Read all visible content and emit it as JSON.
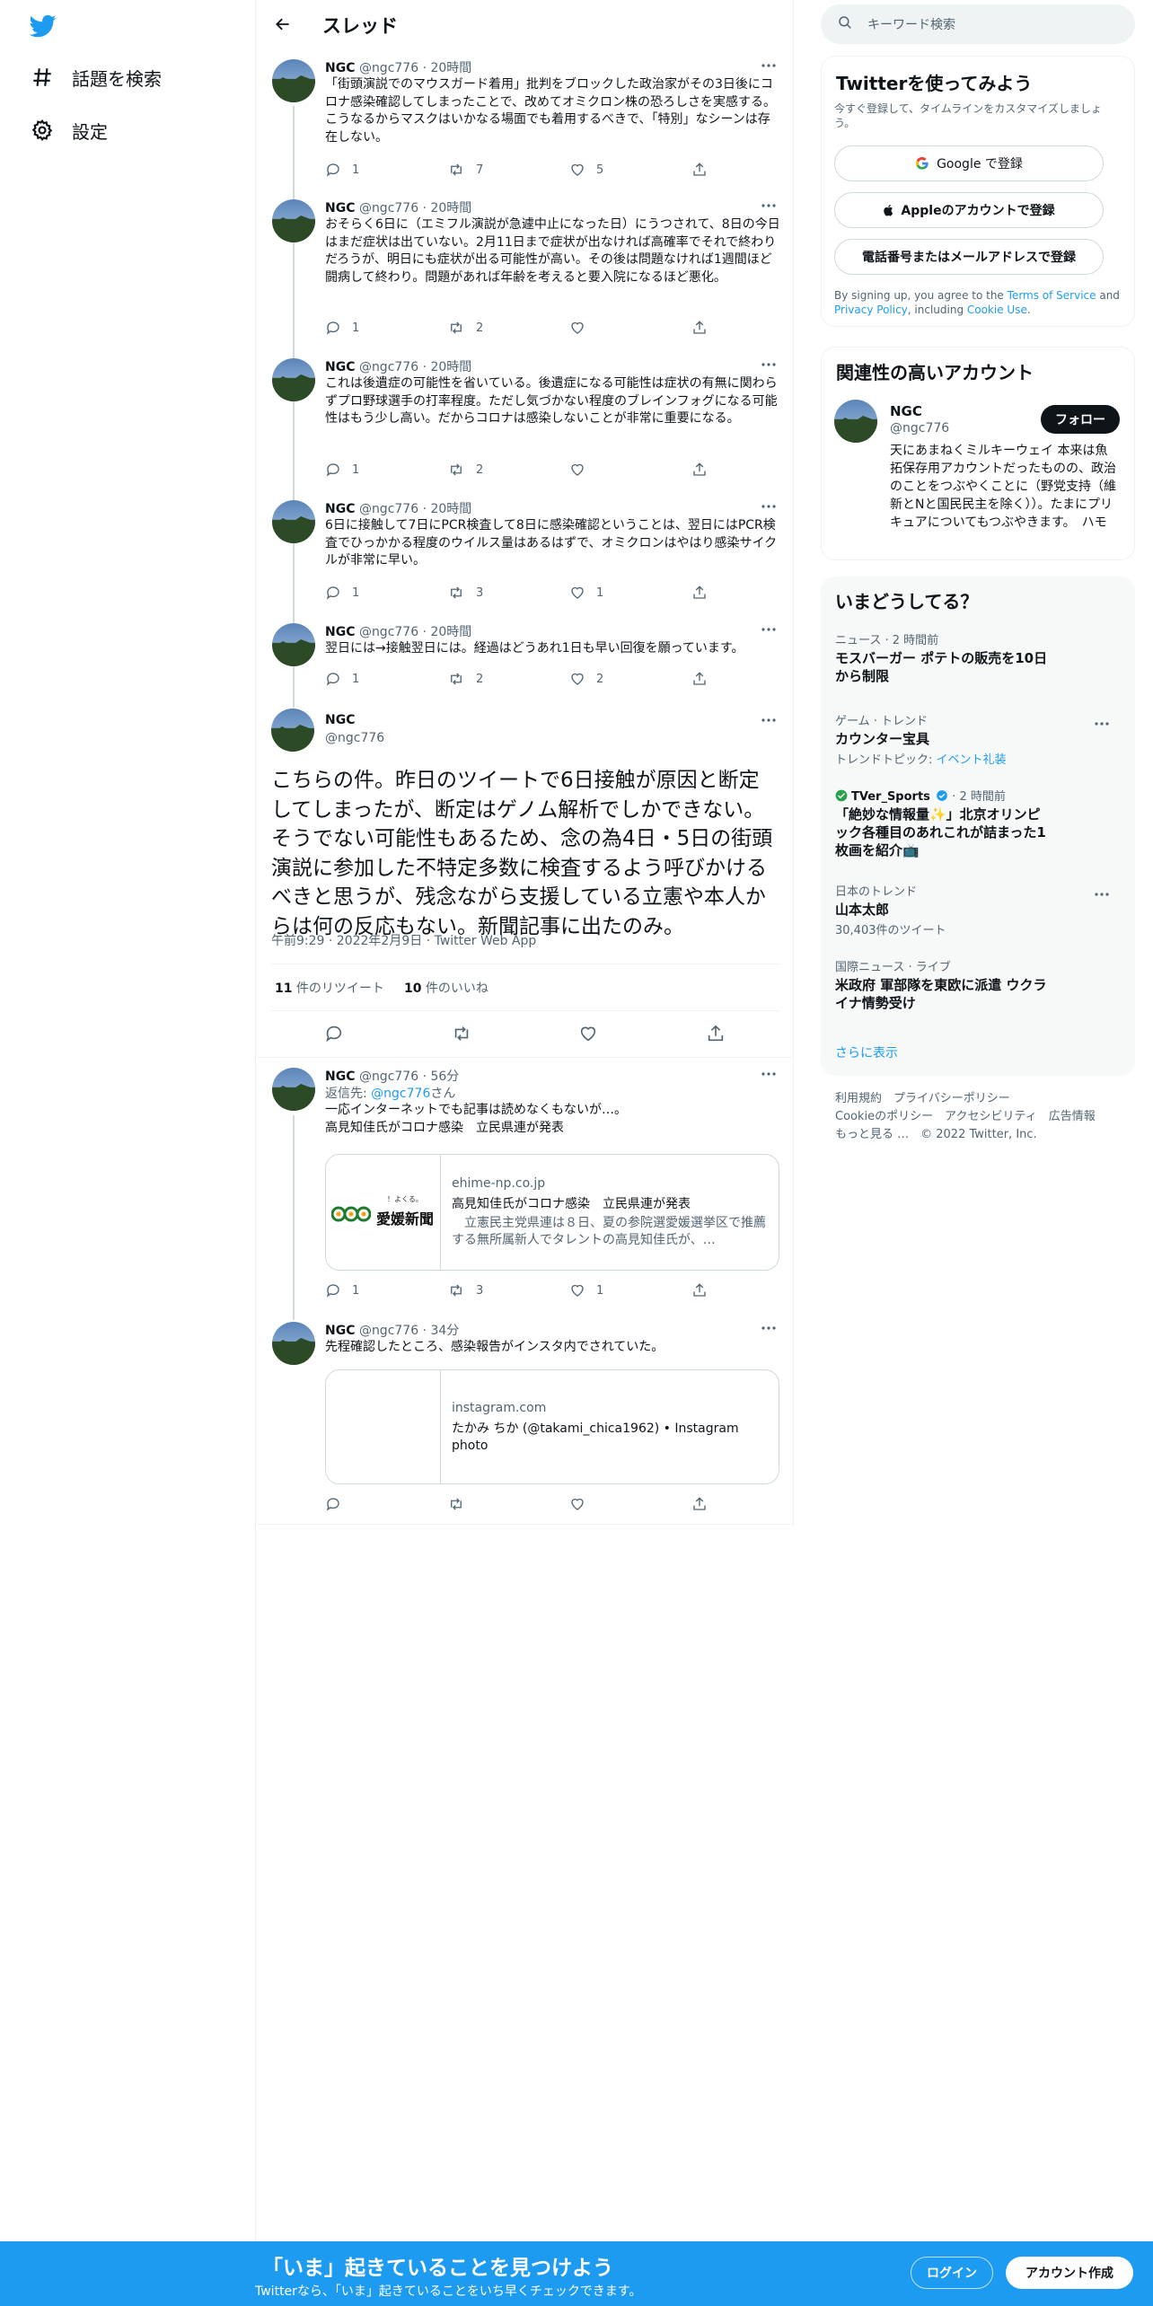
{
  "nav": {
    "explore_label": "話題を検索",
    "settings_label": "設定"
  },
  "header": {
    "title": "スレッド"
  },
  "tweets": [
    {
      "name": "NGC",
      "handle": "@ngc776",
      "time": "20時間",
      "text": "「街頭演説でのマウスガード着用」批判をブロックした政治家がその3日後にコロナ感染確認してしまったことで、改めてオミクロン株の恐ろしさを実感する。こうなるからマスクはいかなる場面でも着用するべきで、「特別」なシーンは存在しない。",
      "replies": "1",
      "retweets": "7",
      "likes": "5"
    },
    {
      "name": "NGC",
      "handle": "@ngc776",
      "time": "20時間",
      "text": "おそらく6日に（エミフル演説が急遽中止になった日）にうつされて、8日の今日はまだ症状は出ていない。2月11日まで症状が出なければ高確率でそれで終わりだろうが、明日にも症状が出る可能性が高い。その後は問題なければ1週間ほど闘病して終わり。問題があれば年齢を考えると要入院になるほど悪化。",
      "replies": "1",
      "retweets": "2",
      "likes": ""
    },
    {
      "name": "NGC",
      "handle": "@ngc776",
      "time": "20時間",
      "text": "これは後遺症の可能性を省いている。後遺症になる可能性は症状の有無に関わらずプロ野球選手の打率程度。ただし気づかない程度のブレインフォグになる可能性はもう少し高い。だからコロナは感染しないことが非常に重要になる。",
      "replies": "1",
      "retweets": "2",
      "likes": ""
    },
    {
      "name": "NGC",
      "handle": "@ngc776",
      "time": "20時間",
      "text": "6日に接触して7日にPCR検査して8日に感染確認ということは、翌日にはPCR検査でひっかかる程度のウイルス量はあるはずで、オミクロンはやはり感染サイクルが非常に早い。",
      "replies": "1",
      "retweets": "3",
      "likes": "1"
    },
    {
      "name": "NGC",
      "handle": "@ngc776",
      "time": "20時間",
      "text": "翌日には→接触翌日には。経過はどうあれ1日も早い回復を願っています。",
      "replies": "1",
      "retweets": "2",
      "likes": "2"
    }
  ],
  "focus": {
    "name": "NGC",
    "handle": "@ngc776",
    "text": "こちらの件。昨日のツイートで6日接触が原因と断定してしまったが、断定はゲノム解析でしかできない。そうでない可能性もあるため、念の為4日・5日の街頭演説に参加した不特定多数に検査するよう呼びかけるべきと思うが、残念ながら支援している立憲や本人からは何の反応もない。新聞記事に出たのみ。",
    "meta": "午前9:29 · 2022年2月9日 · Twitter Web App",
    "retweet_count": "11",
    "retweet_label": " 件のリツイート",
    "like_count": "10",
    "like_label": " 件のいいね"
  },
  "replies": [
    {
      "name": "NGC",
      "handle": "@ngc776",
      "time": "56分",
      "reply_to_label": "返信先: ",
      "reply_to_handle": "@ngc776",
      "reply_to_suffix": "さん",
      "text": "一応インターネットでも記事は読めなくもないが…。\n高見知佳氏がコロナ感染　立民県連が発表",
      "card": {
        "domain": "ehime-np.co.jp",
        "title": "高見知佳氏がコロナ感染　立民県連が発表",
        "desc": "　立憲民主党県連は８日、夏の参院選愛媛選挙区で推薦する無所属新人でタレントの高見知佳氏が、…",
        "logo_text": "愛媛新聞",
        "logo_small": "！よくる。"
      },
      "replies": "1",
      "retweets": "3",
      "likes": "1"
    },
    {
      "name": "NGC",
      "handle": "@ngc776",
      "time": "34分",
      "text": "先程確認したところ、感染報告がインスタ内でされていた。",
      "card": {
        "domain": "instagram.com",
        "title": "たかみ ちか (@takami_chica1962) • Instagram photo"
      },
      "replies": "",
      "retweets": "",
      "likes": ""
    }
  ],
  "search": {
    "placeholder": "キーワード検索"
  },
  "signup": {
    "title": "Twitterを使ってみよう",
    "subtitle": "今すぐ登録して、タイムラインをカスタマイズしましょう。",
    "google": "Google で登録",
    "apple": "Appleのアカウントで登録",
    "phone": "電話番号またはメールアドレスで登録",
    "terms_prefix": "By signing up, you agree to the ",
    "terms_link": "Terms of Service",
    "terms_and": " and ",
    "privacy_link": "Privacy Policy",
    "terms_including": ", including ",
    "cookie_link": "Cookie Use",
    "terms_end": "."
  },
  "related": {
    "title": "関連性の高いアカウント",
    "name": "NGC",
    "handle": "@ngc776",
    "follow": "フォロー",
    "bio": "天にあまねくミルキーウェイ 本来は魚拓保存用アカウントだったものの、政治のことをつぶやくことに（野党支持（維新とNと国民民主を除く））。たまにプリキュアについてもつぶやきます。　ハモ"
  },
  "trends": {
    "title": "いまどうしてる？",
    "items": [
      {
        "category": "ニュース · 2 時間前",
        "title": "モスバーガー ポテトの販売を10日から制限",
        "sub": ""
      },
      {
        "category": "ゲーム · トレンド",
        "title": "カウンター宝具",
        "sub_prefix": "トレンドトピック: ",
        "sub_link": "イベント礼装"
      },
      {
        "category": "TVer_Sports",
        "category_time": " · 2 時間前",
        "title": "「絶妙な情報量✨」北京オリンピック各種目のあれこれが詰まった1枚画を紹介📺",
        "sub": ""
      },
      {
        "category": "日本のトレンド",
        "title": "山本太郎",
        "sub": "30,403件のツイート"
      },
      {
        "category": "国際ニュース · ライブ",
        "title": "米政府 軍部隊を東欧に派遣 ウクライナ情勢受け",
        "sub": ""
      }
    ],
    "show_more": "さらに表示"
  },
  "footer": {
    "line1": "利用規約　プライバシーポリシー",
    "line2": "Cookieのポリシー　アクセシビリティ　広告情報",
    "line3": "もっと見る …　© 2022 Twitter, Inc."
  },
  "bottom": {
    "title": "「いま」起きていることを見つけよう",
    "subtitle": "Twitterなら、「いま」起きていることをいち早くチェックできます。",
    "login": "ログイン",
    "signup": "アカウント作成"
  },
  "colors": {
    "accent": "#1d9bf0",
    "text": "#0f1419",
    "muted": "#536471"
  }
}
